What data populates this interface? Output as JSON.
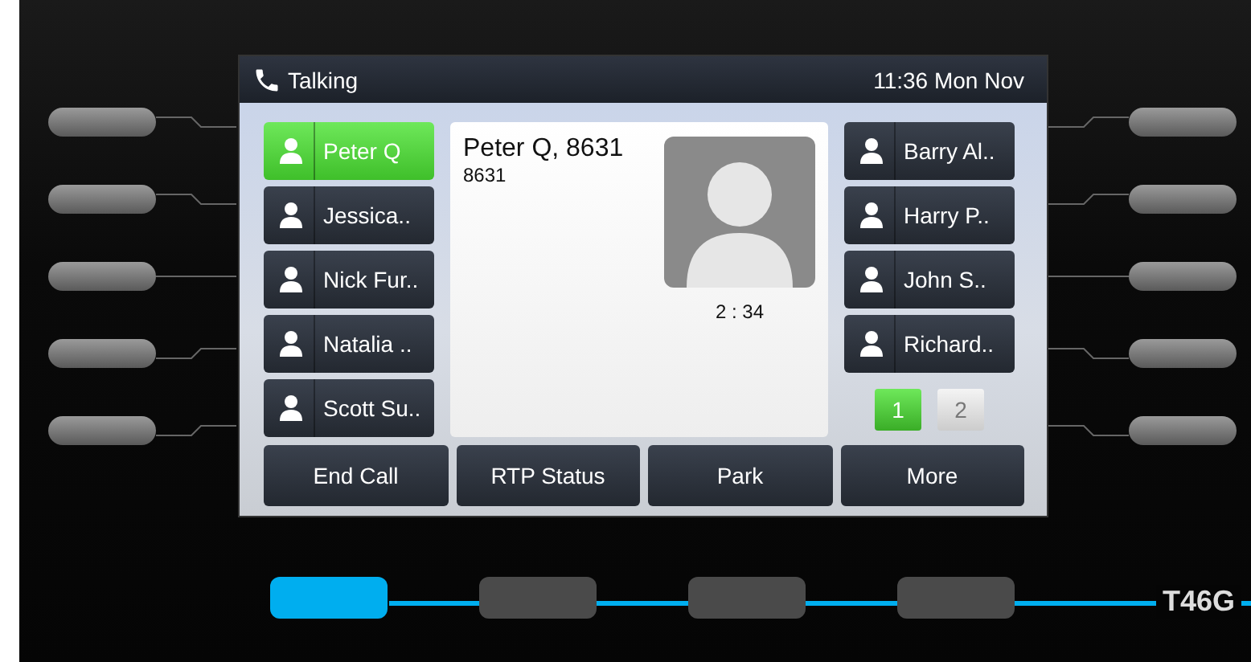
{
  "status_bar": {
    "title": "Talking",
    "clock": "11:36 Mon Nov"
  },
  "left_lines": [
    {
      "label": "Peter Q",
      "selected": true
    },
    {
      "label": "Jessica..",
      "selected": false
    },
    {
      "label": "Nick Fur..",
      "selected": false
    },
    {
      "label": "Natalia ..",
      "selected": false
    },
    {
      "label": "Scott Su..",
      "selected": false
    }
  ],
  "call": {
    "name": "Peter Q, 8631",
    "number": "8631",
    "duration": "2 : 34"
  },
  "right_lines": [
    {
      "label": "Barry Al..",
      "selected": false
    },
    {
      "label": "Harry P..",
      "selected": false
    },
    {
      "label": "John S..",
      "selected": false
    },
    {
      "label": "Richard..",
      "selected": false
    }
  ],
  "pages": [
    {
      "label": "1",
      "selected": true
    },
    {
      "label": "2",
      "selected": false
    }
  ],
  "softkeys": [
    "End Call",
    "RTP Status",
    "Park",
    "More"
  ],
  "hardware_softkeys": [
    {
      "selected": true
    },
    {
      "selected": false
    },
    {
      "selected": false
    },
    {
      "selected": false
    }
  ],
  "model": "T46G"
}
